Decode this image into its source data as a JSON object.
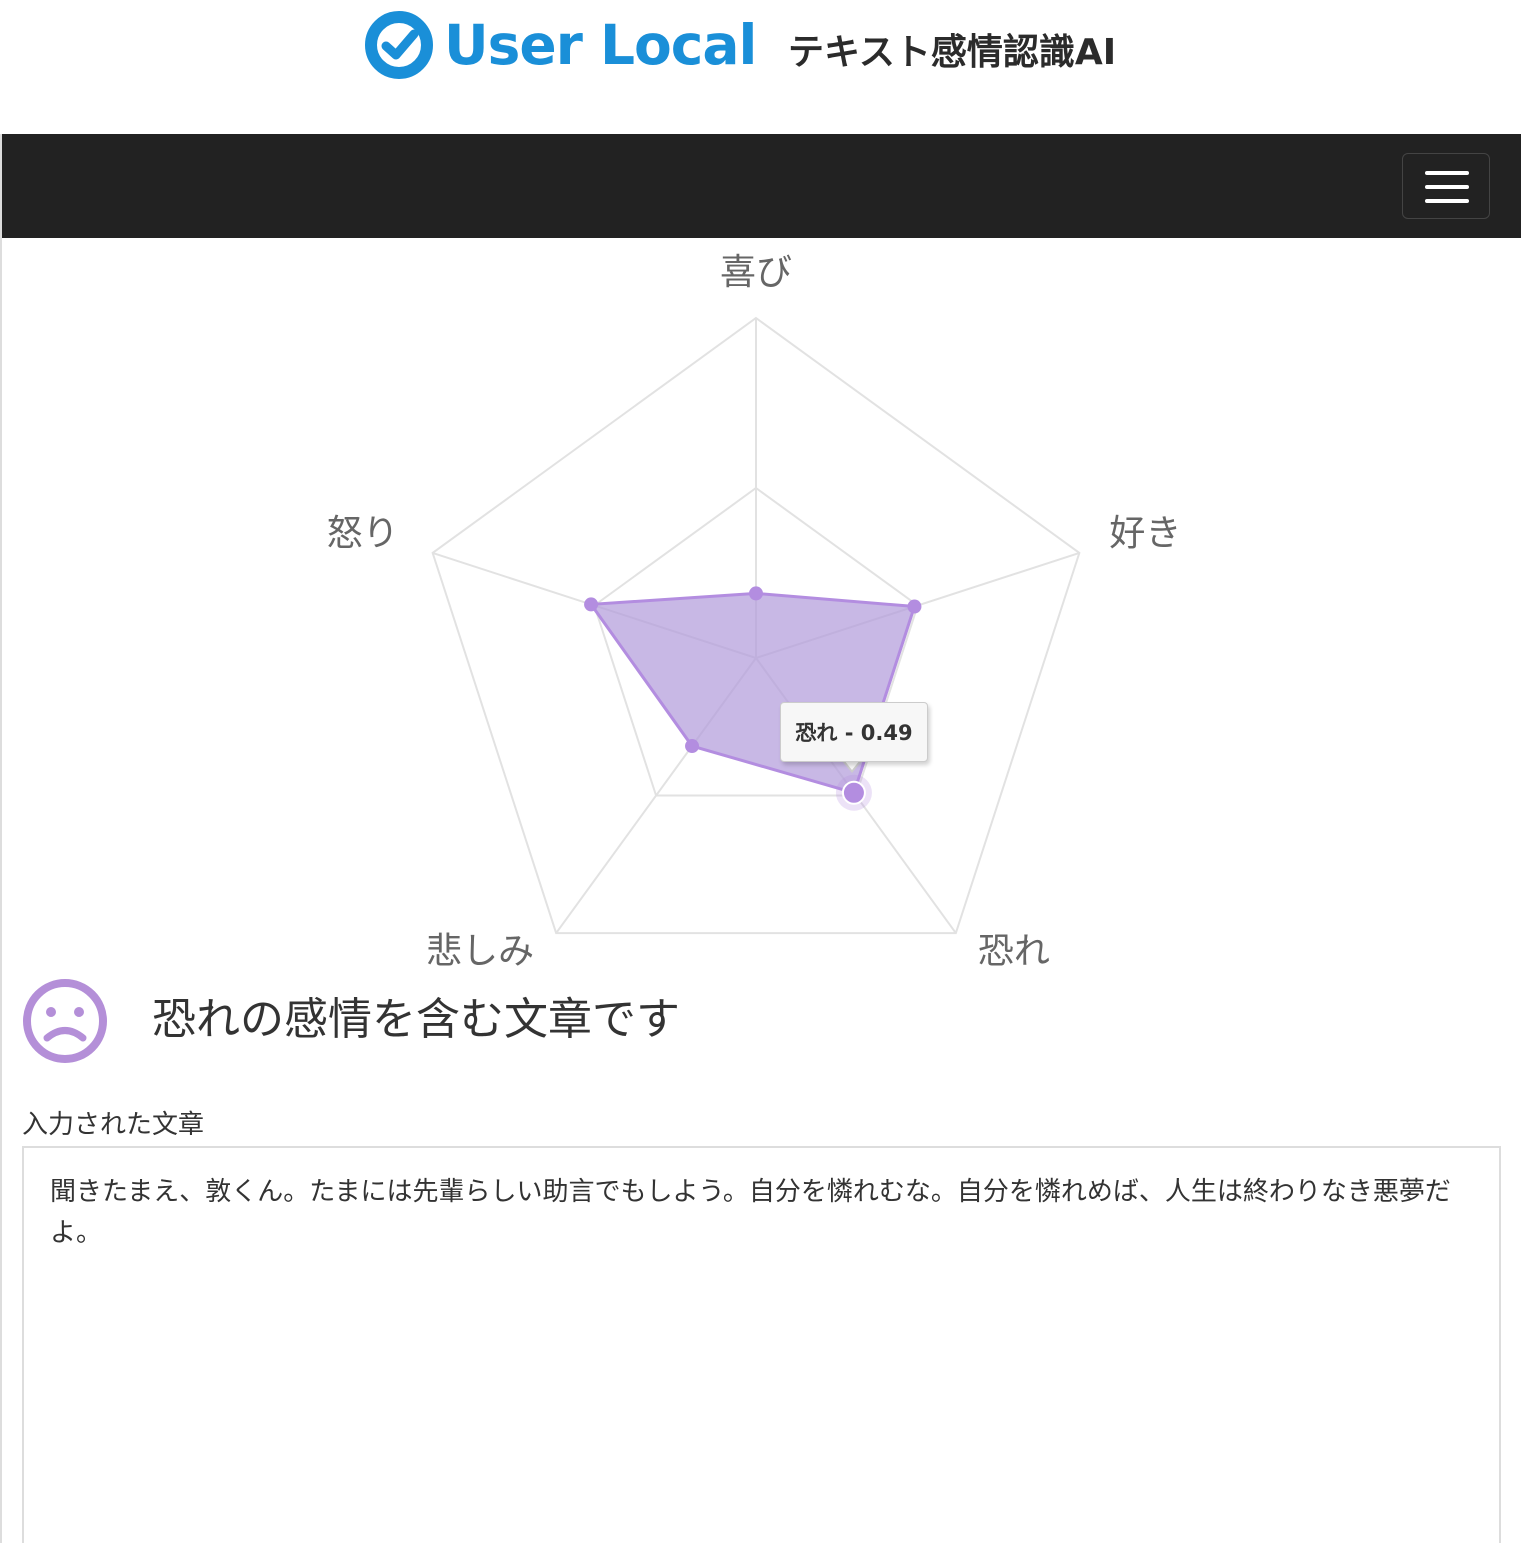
{
  "header": {
    "brand": "User Local",
    "product": "テキスト感情認識AI",
    "brand_color": "#1a8fd8"
  },
  "navbar": {
    "menu_icon": "hamburger-menu-icon",
    "background": "#222222"
  },
  "chart_data": {
    "type": "radar",
    "axes": [
      "喜び",
      "好き",
      "恐れ",
      "悲しみ",
      "怒り"
    ],
    "values": [
      0.19,
      0.49,
      0.49,
      0.32,
      0.51
    ],
    "range": [
      0,
      1
    ],
    "grid_levels": [
      0.5,
      1.0
    ],
    "fill_color": "#b39ddb",
    "point_color": "#b38de0",
    "tooltip": {
      "axis": "恐れ",
      "text": "恐れ - 0.49"
    }
  },
  "result": {
    "icon": "sad-face-icon",
    "icon_color": "#b48fd8",
    "title": "恐れの感情を含む文章です"
  },
  "input": {
    "label": "入力された文章",
    "text": "聞きたまえ、敦くん。たまには先輩らしい助言でもしよう。自分を憐れむな。自分を憐れめば、人生は終わりなき悪夢だよ。"
  }
}
